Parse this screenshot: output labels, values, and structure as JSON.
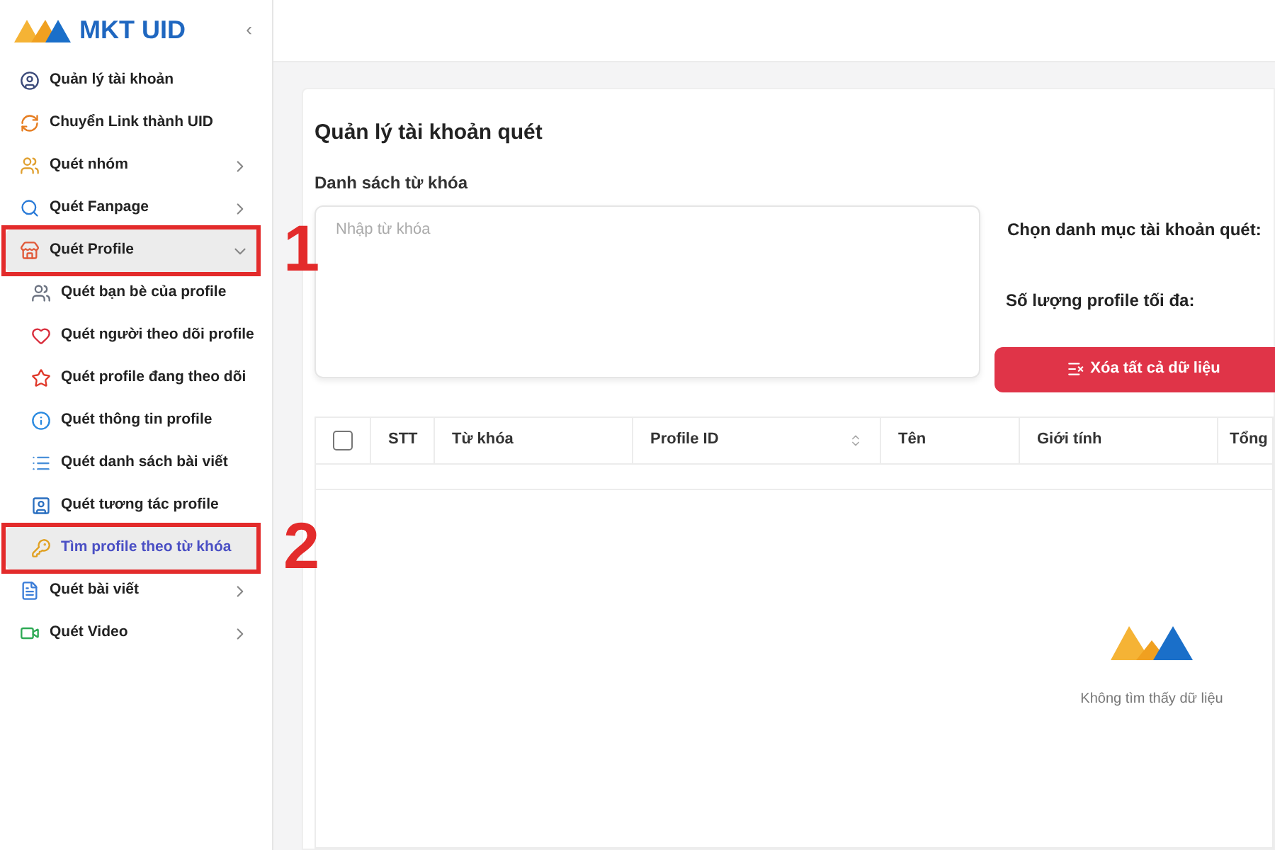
{
  "sidebar": {
    "brand": "MKT UID",
    "collapse": "‹",
    "items": [
      {
        "label": "Quản lý tài khoản",
        "selected": false
      },
      {
        "label": "Chuyển Link thành UID",
        "selected": false
      },
      {
        "label": "Quét nhóm",
        "selected": false,
        "expanded": false
      },
      {
        "label": "Quét Fanpage",
        "selected": false,
        "expanded": false
      },
      {
        "label": "Quét Profile",
        "selected": false,
        "expanded": true,
        "annotation": "1",
        "children": [
          {
            "label": "Quét bạn bè của profile",
            "selected": false
          },
          {
            "label": "Quét người theo dõi profile",
            "selected": false
          },
          {
            "label": "Quét profile đang theo dõi",
            "selected": false
          },
          {
            "label": "Quét thông tin profile",
            "selected": false
          },
          {
            "label": "Quét danh sách bài viết",
            "selected": false
          },
          {
            "label": "Quét tương tác profile",
            "selected": false
          },
          {
            "label": "Tìm profile theo từ khóa",
            "selected": true,
            "annotation": "2"
          }
        ]
      },
      {
        "label": "Quét bài viết",
        "selected": false,
        "expanded": false
      },
      {
        "label": "Quét Video",
        "selected": false,
        "expanded": false
      }
    ]
  },
  "page": {
    "title": "Quản lý tài khoản quét",
    "keywords_label": "Danh sách từ khóa",
    "keywords": {
      "placeholder": "Nhập từ khóa"
    },
    "category_label": "Chọn danh mục tài khoản quét:",
    "max_label": "Số lượng profile tối đa:",
    "clear_button": "Xóa tất cả dữ liệu"
  },
  "table": {
    "select_all": false,
    "columns": [
      {
        "label": "STT"
      },
      {
        "label": "Từ khóa"
      },
      {
        "label": "Profile ID",
        "sortable": true
      },
      {
        "label": "Tên"
      },
      {
        "label": "Giới tính"
      },
      {
        "label": "Tổng"
      }
    ],
    "empty": "Không tìm thấy dữ liệu"
  }
}
